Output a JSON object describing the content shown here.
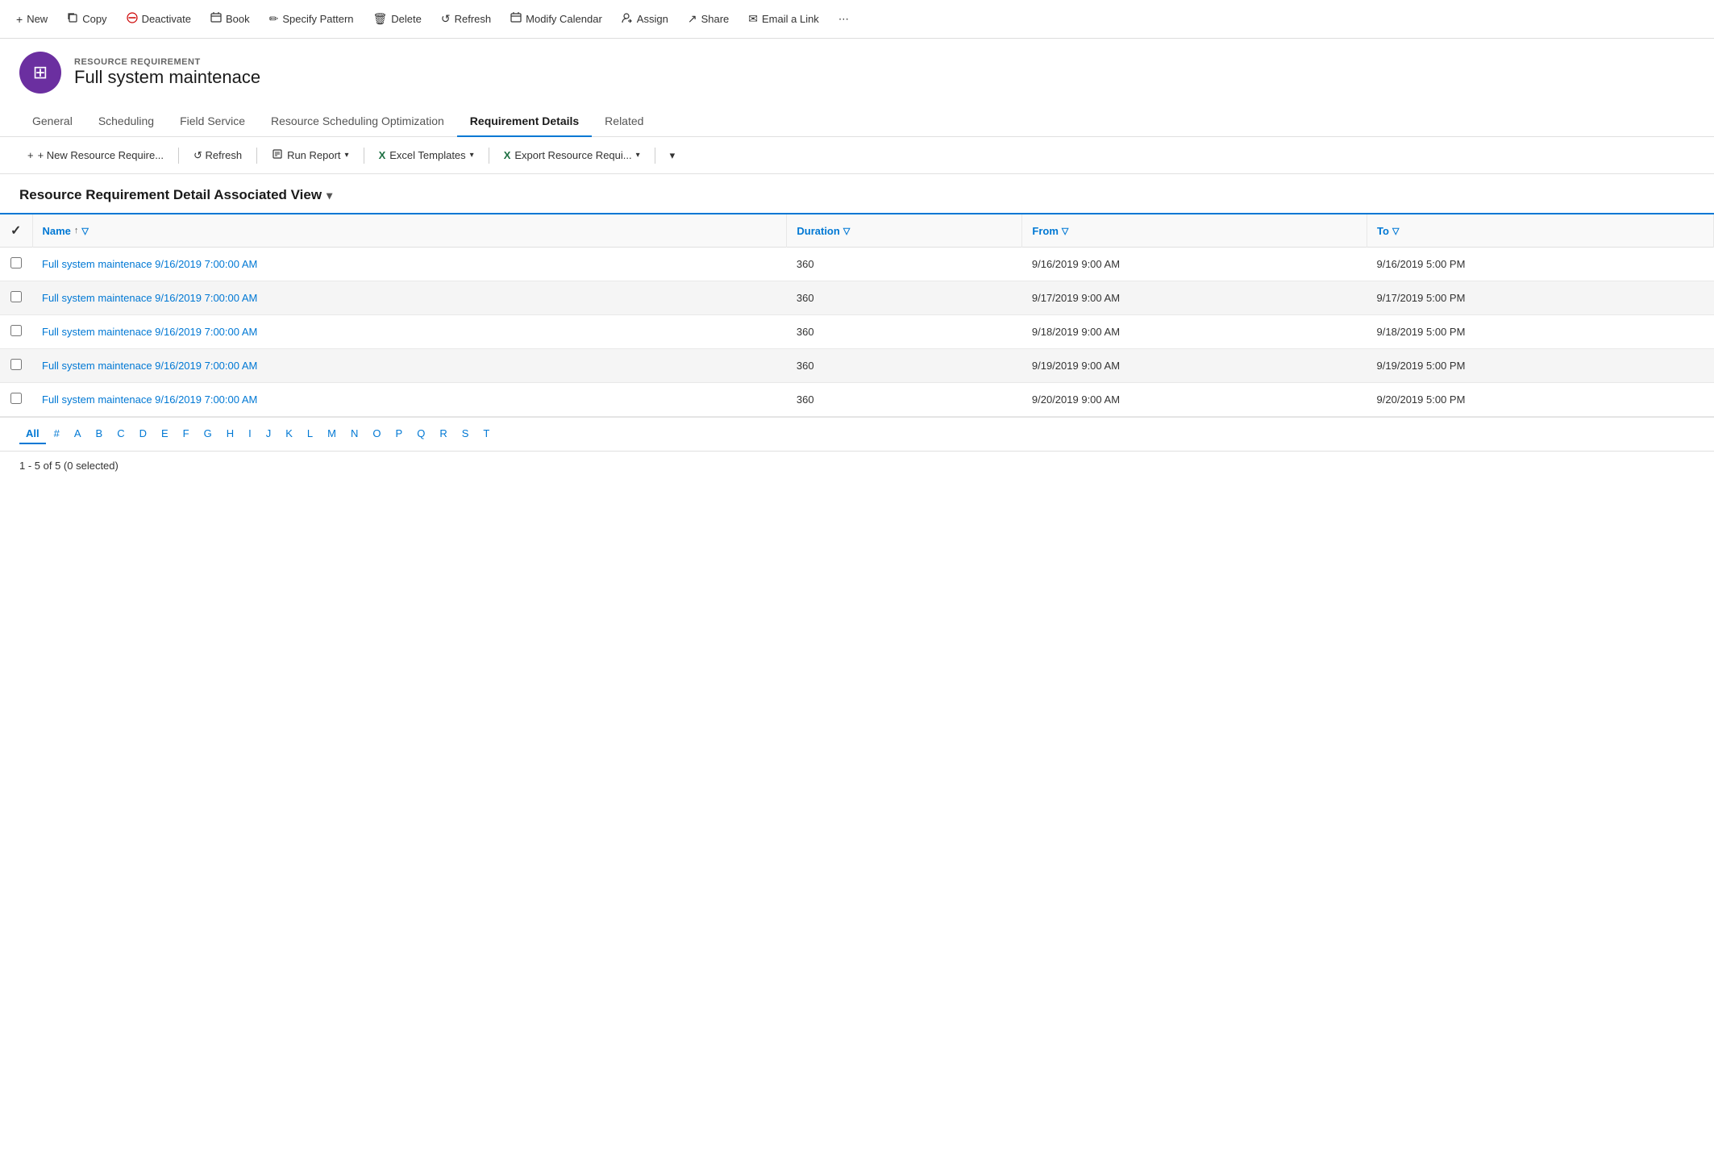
{
  "toolbar": {
    "buttons": [
      {
        "id": "new",
        "label": "New",
        "icon": "+"
      },
      {
        "id": "copy",
        "label": "Copy",
        "icon": "⧉"
      },
      {
        "id": "deactivate",
        "label": "Deactivate",
        "icon": "🚫"
      },
      {
        "id": "book",
        "label": "Book",
        "icon": "📅"
      },
      {
        "id": "specify-pattern",
        "label": "Specify Pattern",
        "icon": "✏️"
      },
      {
        "id": "delete",
        "label": "Delete",
        "icon": "🗑"
      },
      {
        "id": "refresh",
        "label": "Refresh",
        "icon": "↺"
      },
      {
        "id": "modify-calendar",
        "label": "Modify Calendar",
        "icon": "📆"
      },
      {
        "id": "assign",
        "label": "Assign",
        "icon": "👤"
      },
      {
        "id": "share",
        "label": "Share",
        "icon": "↗"
      },
      {
        "id": "email-a-link",
        "label": "Email a Link",
        "icon": "✉"
      }
    ]
  },
  "record": {
    "entity_type": "RESOURCE REQUIREMENT",
    "title": "Full system maintenace",
    "avatar_icon": "⊞"
  },
  "tabs": [
    {
      "id": "general",
      "label": "General",
      "active": false
    },
    {
      "id": "scheduling",
      "label": "Scheduling",
      "active": false
    },
    {
      "id": "field-service",
      "label": "Field Service",
      "active": false
    },
    {
      "id": "resource-scheduling-optimization",
      "label": "Resource Scheduling Optimization",
      "active": false
    },
    {
      "id": "requirement-details",
      "label": "Requirement Details",
      "active": true
    },
    {
      "id": "related",
      "label": "Related",
      "active": false
    }
  ],
  "sub_toolbar": {
    "buttons": [
      {
        "id": "new-resource-require",
        "label": "+ New Resource Require...",
        "has_caret": false
      },
      {
        "id": "refresh",
        "label": "↺  Refresh",
        "has_caret": false
      },
      {
        "id": "run-report",
        "label": "Run Report",
        "has_caret": true
      },
      {
        "id": "excel-templates",
        "label": "Excel Templates",
        "has_caret": true
      },
      {
        "id": "export-resource",
        "label": "Export Resource Requi...",
        "has_caret": true
      }
    ]
  },
  "view": {
    "title": "Resource Requirement Detail Associated View"
  },
  "table": {
    "columns": [
      {
        "id": "name",
        "label": "Name",
        "has_sort": true,
        "has_filter": true
      },
      {
        "id": "duration",
        "label": "Duration",
        "has_sort": false,
        "has_filter": true
      },
      {
        "id": "from",
        "label": "From",
        "has_sort": false,
        "has_filter": true
      },
      {
        "id": "to",
        "label": "To",
        "has_sort": false,
        "has_filter": true
      }
    ],
    "rows": [
      {
        "name": "Full system maintenace 9/16/2019 7:00:00 AM",
        "duration": "360",
        "from": "9/16/2019 9:00 AM",
        "to": "9/16/2019 5:00 PM"
      },
      {
        "name": "Full system maintenace 9/16/2019 7:00:00 AM",
        "duration": "360",
        "from": "9/17/2019 9:00 AM",
        "to": "9/17/2019 5:00 PM"
      },
      {
        "name": "Full system maintenace 9/16/2019 7:00:00 AM",
        "duration": "360",
        "from": "9/18/2019 9:00 AM",
        "to": "9/18/2019 5:00 PM"
      },
      {
        "name": "Full system maintenace 9/16/2019 7:00:00 AM",
        "duration": "360",
        "from": "9/19/2019 9:00 AM",
        "to": "9/19/2019 5:00 PM"
      },
      {
        "name": "Full system maintenace 9/16/2019 7:00:00 AM",
        "duration": "360",
        "from": "9/20/2019 9:00 AM",
        "to": "9/20/2019 5:00 PM"
      }
    ]
  },
  "pagination": {
    "letters": [
      "All",
      "#",
      "A",
      "B",
      "C",
      "D",
      "E",
      "F",
      "G",
      "H",
      "I",
      "J",
      "K",
      "L",
      "M",
      "N",
      "O",
      "P",
      "Q",
      "R",
      "S",
      "T"
    ],
    "active": "All"
  },
  "status": {
    "text": "1 - 5 of 5 (0 selected)"
  }
}
